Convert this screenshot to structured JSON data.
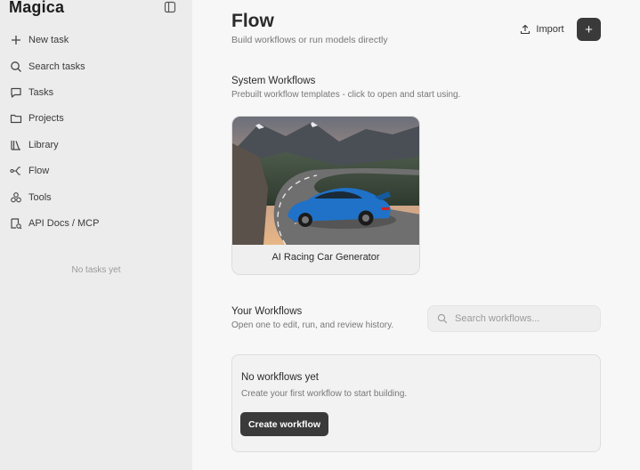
{
  "brand": {
    "name": "Magica"
  },
  "sidebar": {
    "items": [
      {
        "label": "New task",
        "icon": "plus-icon"
      },
      {
        "label": "Search tasks",
        "icon": "search-icon"
      },
      {
        "label": "Tasks",
        "icon": "chat-icon"
      },
      {
        "label": "Projects",
        "icon": "folder-icon"
      },
      {
        "label": "Library",
        "icon": "library-icon"
      },
      {
        "label": "Flow",
        "icon": "flow-icon"
      },
      {
        "label": "Tools",
        "icon": "tools-icon"
      },
      {
        "label": "API Docs / MCP",
        "icon": "api-docs-icon"
      }
    ],
    "empty_text": "No tasks yet"
  },
  "header": {
    "title": "Flow",
    "subtitle": "Build workflows or run models directly",
    "import_label": "Import",
    "add_label": "+"
  },
  "system_workflows": {
    "title": "System Workflows",
    "subtitle": "Prebuilt workflow templates - click to open and start using.",
    "cards": [
      {
        "label": "AI Racing Car Generator"
      }
    ]
  },
  "your_workflows": {
    "title": "Your Workflows",
    "subtitle": "Open one to edit, run, and review history.",
    "search_placeholder": "Search workflows...",
    "empty_title": "No workflows yet",
    "empty_subtitle": "Create your first workflow to start building.",
    "create_label": "Create workflow"
  },
  "colors": {
    "sidebar_bg": "#ececec",
    "main_bg": "#f7f7f7",
    "dark_button": "#3a3a3a"
  }
}
